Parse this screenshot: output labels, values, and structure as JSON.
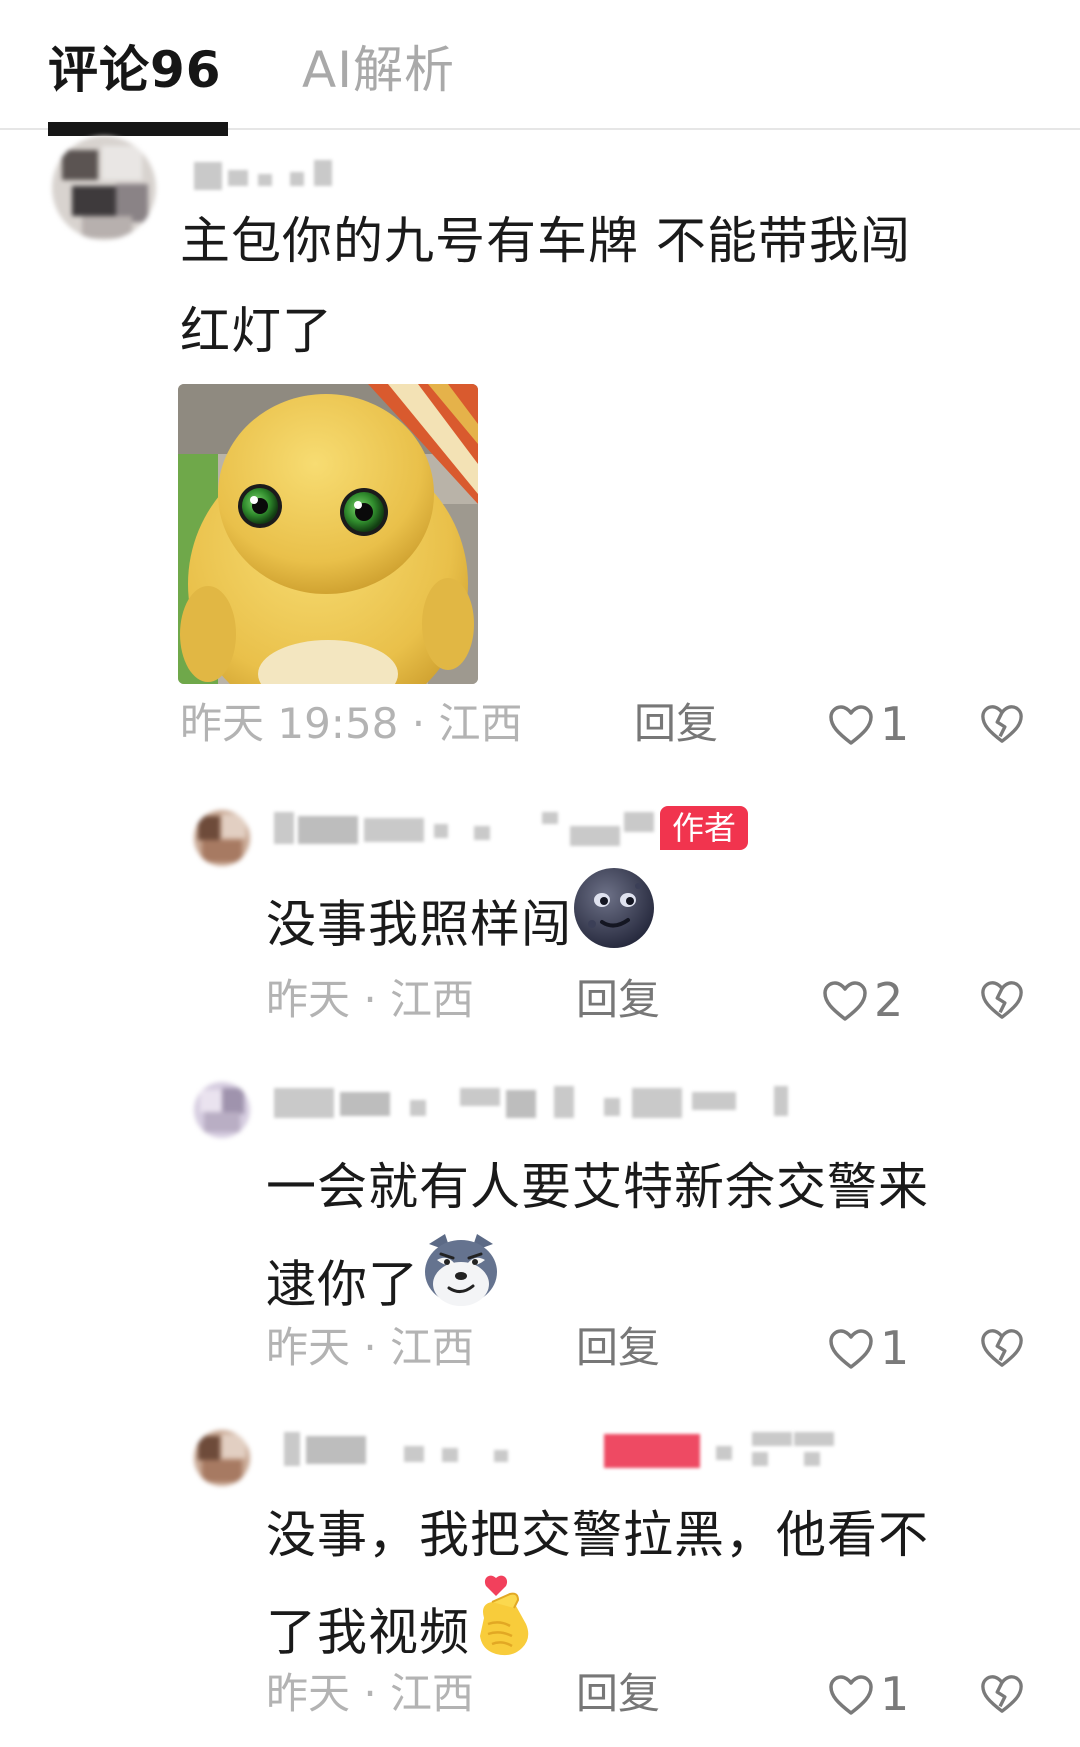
{
  "tabs": {
    "comments_label": "评论96",
    "ai_label": "AI解析"
  },
  "comments": [
    {
      "text_line1": "主包你的九号有车牌 不能带我闯",
      "text_line2": "红灯了",
      "time": "昨天 19:58 · 江西",
      "reply_label": "回复",
      "likes": "1"
    },
    {
      "author_badge": "作者",
      "text": "没事我照样闯",
      "emoji": "moon-face-emoji",
      "time": "昨天 · 江西",
      "reply_label": "回复",
      "likes": "2"
    },
    {
      "text_line1": "一会就有人要艾特新余交警来",
      "text_line2": "逮你了",
      "emoji": "smirking-wolf-emoji",
      "time": "昨天 · 江西",
      "reply_label": "回复",
      "likes": "1"
    },
    {
      "text_line1": "没事，我把交警拉黑，他看不",
      "text_line2": "了我视频",
      "emoji": "finger-heart-emoji",
      "time": "昨天 · 江西",
      "reply_label": "回复",
      "likes": "1"
    }
  ],
  "colors": {
    "accent_badge": "#f1344e",
    "meta_text": "#b3b3b3",
    "inactive_tab": "#a9a9a9"
  }
}
